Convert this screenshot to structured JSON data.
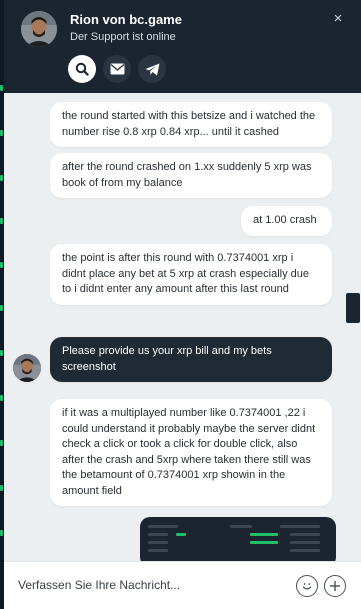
{
  "header": {
    "title": "Rion von bc.game",
    "subtitle": "Der Support ist online",
    "actions": [
      {
        "icon": "search-icon"
      },
      {
        "icon": "email-icon"
      },
      {
        "icon": "telegram-icon"
      }
    ],
    "close_label": "×"
  },
  "messages": [
    {
      "from": "user",
      "text": "the round started with this betsize and i watched the number rise 0.8 xrp 0.84 xrp... until it cashed"
    },
    {
      "from": "user",
      "text": "after the round crashed on 1.xx suddenly 5 xrp was book of from my balance"
    },
    {
      "from": "user",
      "text": "at 1.00 crash"
    },
    {
      "from": "user",
      "text": "the point is after this round with 0.7374001 xrp i didnt place any bet at 5 xrp at crash especially due to i didnt enter any amount after this last round"
    },
    {
      "from": "agent",
      "text": "Please provide us your xrp bill and my bets screenshot"
    },
    {
      "from": "user",
      "text": "if it was a multiplayed number like 0.7374001 ,22 i could understand it probably maybe the server didnt check a click or took a click for double click, also after the crash and 5xrp where taken there still was the betamount of 0.7374001 xrp showin in the amount field"
    }
  ],
  "composer": {
    "placeholder": "Verfassen Sie Ihre Nachricht..."
  },
  "colors": {
    "header_bg": "#1b2530",
    "agent_bubble": "#1f2a35",
    "chat_bg": "#eceff1",
    "accent_green": "#1fbf6a"
  }
}
